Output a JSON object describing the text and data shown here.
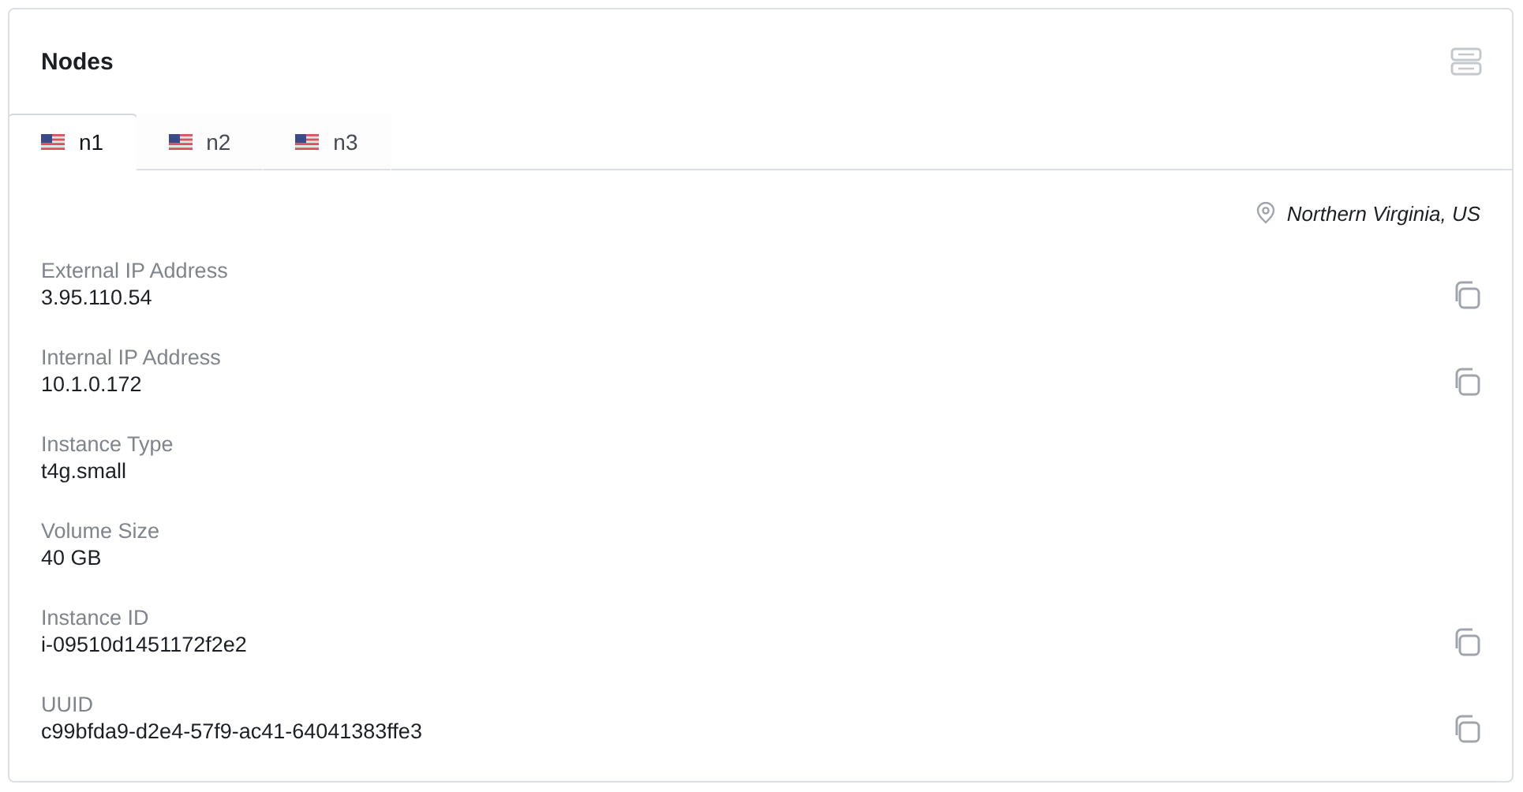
{
  "title": "Nodes",
  "tabs": [
    {
      "label": "n1",
      "selected": true
    },
    {
      "label": "n2",
      "selected": false
    },
    {
      "label": "n3",
      "selected": false
    }
  ],
  "location": "Northern Virginia, US",
  "fields": [
    {
      "label": "External IP Address",
      "value": "3.95.110.54",
      "copyable": true
    },
    {
      "label": "Internal IP Address",
      "value": "10.1.0.172",
      "copyable": true
    },
    {
      "label": "Instance Type",
      "value": "t4g.small",
      "copyable": false
    },
    {
      "label": "Volume Size",
      "value": "40 GB",
      "copyable": false
    },
    {
      "label": "Instance ID",
      "value": "i-09510d1451172f2e2",
      "copyable": true
    },
    {
      "label": "UUID",
      "value": "c99bfda9-d2e4-57f9-ac41-64041383ffe3",
      "copyable": true
    }
  ]
}
